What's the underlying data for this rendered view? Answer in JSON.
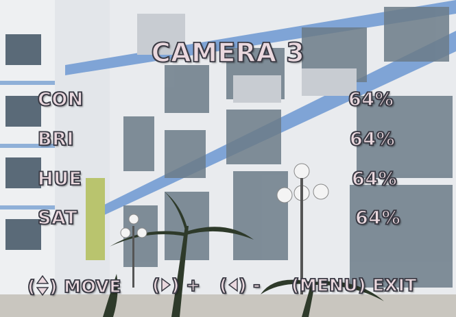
{
  "osd": {
    "title": "CAMERA 3",
    "settings": [
      {
        "label": "CON",
        "value": "64%"
      },
      {
        "label": "BRI",
        "value": "64%"
      },
      {
        "label": "HUE",
        "value": "64%"
      },
      {
        "label": "SAT",
        "value": "64%"
      }
    ],
    "footer": {
      "move_label": "MOVE",
      "plus_label": "+",
      "minus_label": "-",
      "exit_label": "(MENU) EXIT"
    },
    "icons": {
      "move": "up-down-arrows-icon",
      "plus": "right-arrow-icon",
      "minus": "left-arrow-icon"
    },
    "colors": {
      "text": "#ead8de",
      "outline": "#3a3a44"
    }
  }
}
